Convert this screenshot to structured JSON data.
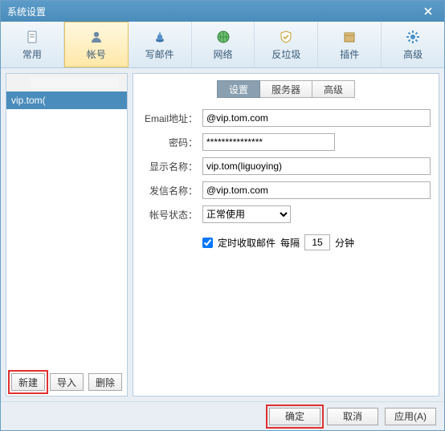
{
  "window": {
    "title": "系统设置"
  },
  "toolbar": {
    "items": [
      {
        "label": "常用"
      },
      {
        "label": "帐号"
      },
      {
        "label": "写邮件"
      },
      {
        "label": "网络"
      },
      {
        "label": "反垃圾"
      },
      {
        "label": "插件"
      },
      {
        "label": "高级"
      }
    ],
    "active_index": 1
  },
  "left": {
    "accounts": [
      {
        "label": ""
      },
      {
        "label": "vip.tom("
      }
    ],
    "selected_index": 1,
    "buttons": {
      "new": "新建",
      "import": "导入",
      "delete": "删除"
    }
  },
  "inner_tabs": {
    "items": [
      {
        "label": "设置"
      },
      {
        "label": "服务器"
      },
      {
        "label": "高级"
      }
    ],
    "active_index": 0
  },
  "form": {
    "email_label": "Email地址：",
    "email_value": "@vip.tom.com",
    "password_label": "密码：",
    "password_value": "***************",
    "displayname_label": "显示名称：",
    "displayname_value": "vip.tom(liguoying)",
    "sendername_label": "发信名称：",
    "sendername_value": "@vip.tom.com",
    "status_label": "帐号状态：",
    "status_value": "正常使用",
    "timed_check_checked": true,
    "timed_check_label": "定时收取邮件",
    "interval_prefix": "每隔",
    "interval_value": "15",
    "interval_suffix": "分钟"
  },
  "dialog_buttons": {
    "ok": "确定",
    "cancel": "取消",
    "apply": "应用(A)"
  }
}
